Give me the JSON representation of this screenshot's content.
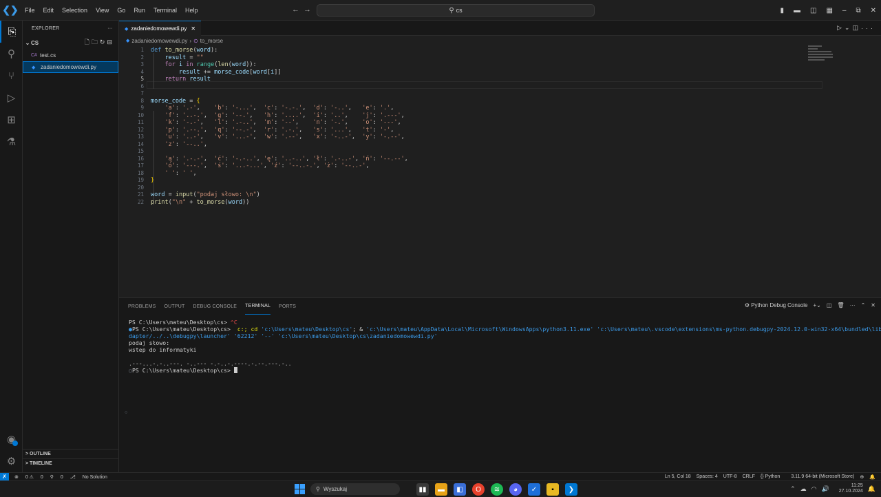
{
  "titlebar": {
    "menu": [
      "File",
      "Edit",
      "Selection",
      "View",
      "Go",
      "Run",
      "Terminal",
      "Help"
    ],
    "search_text": "cs"
  },
  "sidebar": {
    "title": "EXPLORER",
    "more": "···",
    "folder": "CS",
    "files": [
      {
        "name": "test.cs",
        "icon": "C#"
      },
      {
        "name": "zadaniedomowewdi.py",
        "icon": "py"
      }
    ],
    "outline": "OUTLINE",
    "timeline": "TIMELINE"
  },
  "editor": {
    "tab_name": "zadaniedomowewdi.py",
    "breadcrumb": {
      "file": "zadaniedomowewdi.py",
      "symbol": "to_morse"
    },
    "line_numbers": [
      "1",
      "2",
      "3",
      "4",
      "5",
      "6",
      "7",
      "8",
      "9",
      "10",
      "11",
      "12",
      "13",
      "14",
      "15",
      "16",
      "17",
      "18",
      "19",
      "20",
      "21",
      "22"
    ],
    "current_line": "5"
  },
  "panel": {
    "tabs": [
      "PROBLEMS",
      "OUTPUT",
      "DEBUG CONSOLE",
      "TERMINAL",
      "PORTS"
    ],
    "active_tab": "TERMINAL",
    "terminal_name": "Python Debug Console",
    "terminal": {
      "line1_prompt": "PS C:\\Users\\mateu\\Desktop\\cs> ",
      "line1_cmd": "^C",
      "line2_prompt": "PS C:\\Users\\mateu\\Desktop\\cs> ",
      "line2_cmd_a": " c:; cd ",
      "line2_str1": "'c:\\Users\\mateu\\Desktop\\cs'",
      "line2_cmd_b": "; & ",
      "line2_str2": "'c:\\Users\\mateu\\AppData\\Local\\Microsoft\\WindowsApps\\python3.11.exe'",
      "line2_str3": " 'c:\\Users\\mateu\\.vscode\\extensions\\ms-python.debugpy-2024.12.0-win32-x64\\bundled\\libs\\debugpy\\a",
      "line3": "dapter/../..\\debugpy\\launcher' '62212' '--' 'c:\\Users\\mateu\\Desktop\\cs\\zadaniedomowewdi.py'",
      "line4": "podaj słowo:",
      "line5": "wstep do informatyki",
      "line7": ".---...-.-..---. -..--- -.-..-.----.-.--.---.-..",
      "line8_prompt": "PS C:\\Users\\mateu\\Desktop\\cs> "
    }
  },
  "statusbar": {
    "errors": "0",
    "warnings": "0",
    "ports": "0",
    "solution": "No Solution",
    "position": "Ln 5, Col 18",
    "spaces": "Spaces: 4",
    "encoding": "UTF-8",
    "eol": "CRLF",
    "language": "Python",
    "interpreter": "3.11.9 64-bit (Microsoft Store)"
  },
  "taskbar": {
    "search_placeholder": "Wyszukaj",
    "time": "11:25",
    "date": "27.10.2024"
  },
  "colors": {
    "accent": "#0078d4",
    "keyword": "#c586c0",
    "def": "#569cd6",
    "function": "#dcdcaa",
    "string": "#ce9178",
    "variable": "#9cdcfe"
  }
}
